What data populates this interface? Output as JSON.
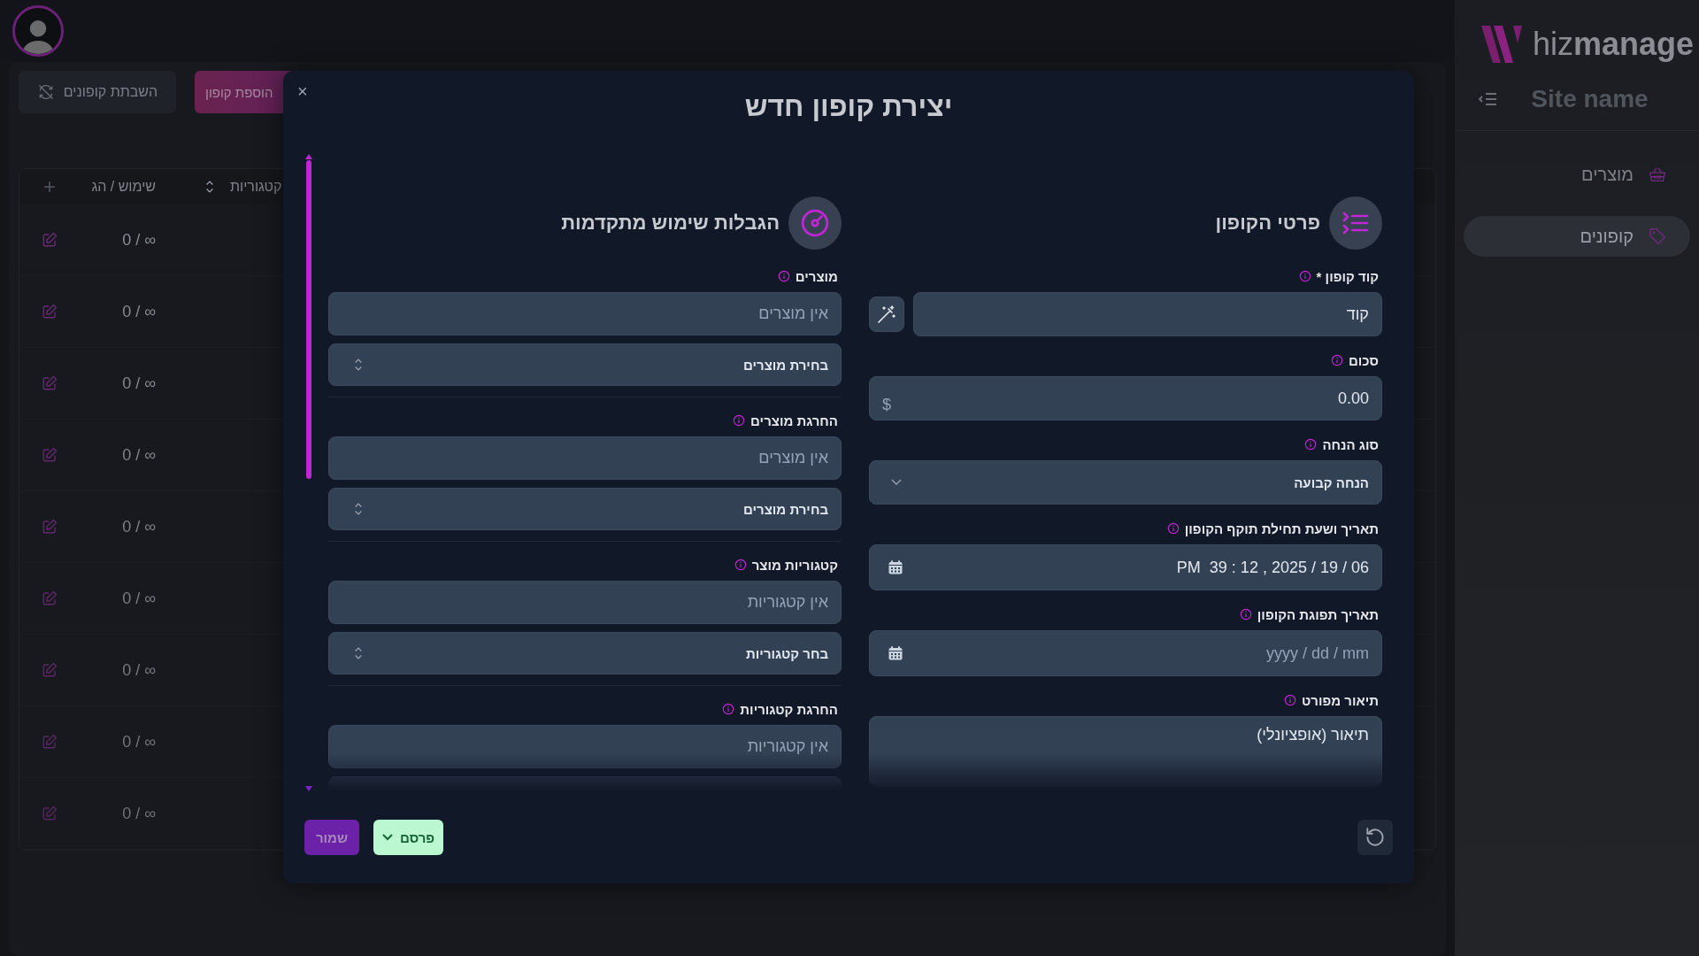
{
  "sidebar": {
    "logo_text": "hiz**manage**",
    "site_name": "Site name",
    "items": [
      {
        "label": "מוצרים",
        "selected": false
      },
      {
        "label": "קופונים",
        "selected": true
      }
    ]
  },
  "toolbar": {
    "buttons": [
      {
        "label": "הוספת קופון",
        "kind": "primary"
      },
      {
        "label": "השבתת קופונים",
        "kind": "secondary"
      }
    ]
  },
  "table": {
    "columns": [
      {
        "label": "קטגוריות",
        "sortable": true
      },
      {
        "label": "שימוש / הג",
        "sortable": false
      }
    ],
    "add_column": "+",
    "rows": [
      {
        "usage": "∞ / 0"
      },
      {
        "usage": "∞ / 0"
      },
      {
        "usage": "∞ / 0"
      },
      {
        "usage": "∞ / 0"
      },
      {
        "usage": "∞ / 0"
      },
      {
        "usage": "∞ / 0"
      },
      {
        "usage": "∞ / 0"
      },
      {
        "usage": "∞ / 0"
      },
      {
        "usage": "∞ / 0"
      }
    ]
  },
  "modal": {
    "close": "×",
    "title": "יצירת קופון חדש",
    "sections": [
      {
        "title": "פרטי הקופון",
        "fields": [
          {
            "kind": "text",
            "label": "קוד קופון *",
            "value": "קוד"
          },
          {
            "kind": "money",
            "label": "סכום",
            "value": "0.00",
            "suffix": "$"
          },
          {
            "kind": "select",
            "label": "סוג הנחה",
            "value": "הנחה קבועה"
          },
          {
            "kind": "datetime",
            "label": "תאריך ושעת תחילת תוקף הקופון",
            "value": "PM  39 : 12 , 2025 / 19 / 06"
          },
          {
            "kind": "date",
            "label": "תאריך תפוגת הקופון",
            "placeholder": "yyyy / dd / mm"
          },
          {
            "kind": "textarea",
            "label": "תיאור מפורט",
            "placeholder": "תיאור (אופציונלי)"
          }
        ]
      },
      {
        "title": "הגבלות שימוש מתקדמות",
        "fields": [
          {
            "kind": "picker",
            "label": "מוצרים",
            "empty": "אין מוצרים",
            "select": "בחירת מוצרים"
          },
          {
            "kind": "picker",
            "label": "החרגת מוצרים",
            "empty": "אין מוצרים",
            "select": "בחירת מוצרים"
          },
          {
            "kind": "picker",
            "label": "קטגוריות מוצר",
            "empty": "אין קטגוריות",
            "select": "בחר קטגוריות"
          },
          {
            "kind": "picker",
            "label": "החרגת קטגוריות",
            "empty": "אין קטגוריות"
          }
        ]
      }
    ],
    "footer": {
      "publish": "פרסם",
      "save": "שמור"
    }
  }
}
